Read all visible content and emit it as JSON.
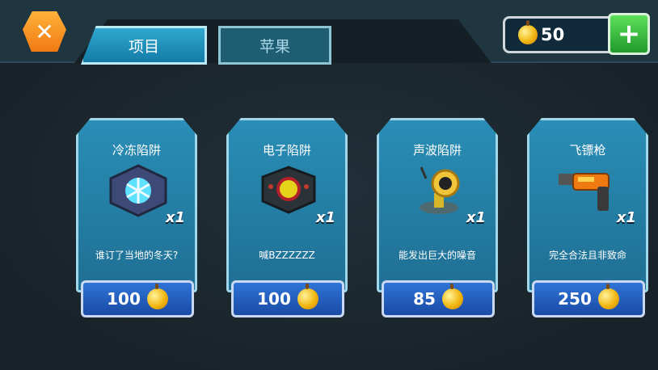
{
  "header": {
    "tabs": [
      {
        "label": "项目",
        "active": true
      },
      {
        "label": "苹果",
        "active": false
      }
    ],
    "currency": {
      "value": "50",
      "icon": "apple-icon"
    },
    "close_icon": "close-icon",
    "add_icon": "plus-icon"
  },
  "items": [
    {
      "title": "冷冻陷阱",
      "qty": "x1",
      "desc": "谁订了当地的冬天?",
      "price": "100",
      "icon": "freeze-trap-icon"
    },
    {
      "title": "电子陷阱",
      "qty": "x1",
      "desc": "喊BZZZZZZ",
      "price": "100",
      "icon": "electric-trap-icon"
    },
    {
      "title": "声波陷阱",
      "qty": "x1",
      "desc": "能发出巨大的噪音",
      "price": "85",
      "icon": "sonic-trap-icon"
    },
    {
      "title": "飞镖枪",
      "qty": "x1",
      "desc": "完全合法且非致命",
      "price": "250",
      "icon": "dart-gun-icon"
    }
  ],
  "colors": {
    "accent": "#2fa8d0",
    "card": "#2a8eb6",
    "price_button": "#2f74d6",
    "apple": "#f2b610",
    "add": "#1f9a2b",
    "close": "#f07a12"
  }
}
